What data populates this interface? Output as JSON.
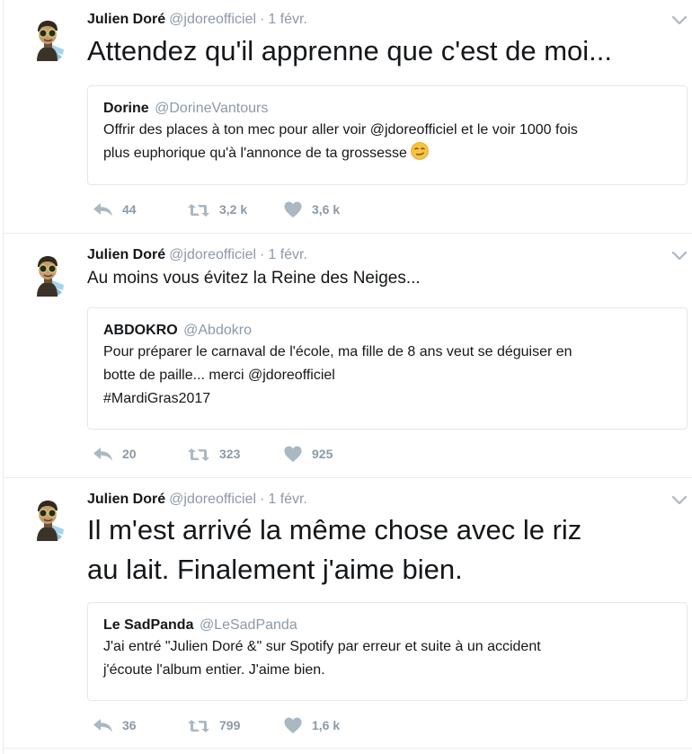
{
  "tweets": [
    {
      "author": {
        "name": "Julien Doré",
        "handle": "@jdoreofficiel"
      },
      "time": "1 févr.",
      "text": "Attendez qu'il apprenne que c'est de moi...",
      "quote": {
        "author": {
          "name": "Dorine",
          "handle": "@DorineVantours"
        },
        "lines": [
          "Offrir des places à ton mec pour aller voir @jdoreofficiel et le voir 1000 fois",
          "plus euphorique qu'à l'annonce de ta grossesse"
        ],
        "emoji": "smirking-face-emoji"
      },
      "stats": {
        "replies": "44",
        "retweets": "3,2 k",
        "likes": "3,6 k"
      }
    },
    {
      "author": {
        "name": "Julien Doré",
        "handle": "@jdoreofficiel"
      },
      "time": "1 févr.",
      "text": "Au moins vous évitez la Reine des Neiges...",
      "quote": {
        "author": {
          "name": "ABDOKRO",
          "handle": "@Abdokro"
        },
        "lines": [
          "Pour préparer le carnaval de l'école, ma fille de 8 ans veut se déguiser en",
          "botte de paille... merci @jdoreofficiel",
          "#MardiGras2017"
        ]
      },
      "stats": {
        "replies": "20",
        "retweets": "323",
        "likes": "925"
      }
    },
    {
      "author": {
        "name": "Julien Doré",
        "handle": "@jdoreofficiel"
      },
      "time": "1 févr.",
      "text_lines": [
        "Il m'est arrivé la même chose avec le riz",
        "au lait. Finalement j'aime bien."
      ],
      "quote": {
        "author": {
          "name": "Le SadPanda",
          "handle": "@LeSadPanda"
        },
        "lines": [
          "J'ai entré \"Julien Doré &\" sur Spotify par erreur et suite à un accident",
          "j'écoute l'album entier. J'aime bien."
        ]
      },
      "stats": {
        "replies": "36",
        "retweets": "799",
        "likes": "1,6 k"
      }
    }
  ],
  "header_separator": "·",
  "icons": {
    "avatar": "avatar-icon",
    "caret": "chevron-down-icon",
    "reply": "reply-icon",
    "retweet": "retweet-icon",
    "like": "heart-icon"
  },
  "colors": {
    "text": "#14171a",
    "muted": "#8a9aa8",
    "border": "#e1e8ed",
    "icon": "#aab8c2"
  }
}
